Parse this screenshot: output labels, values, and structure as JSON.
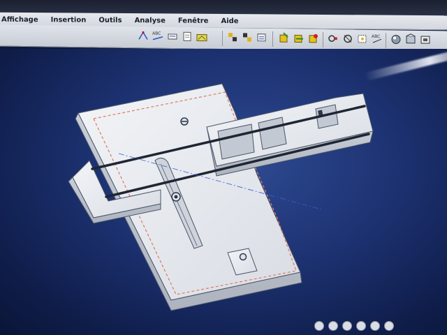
{
  "menubar": {
    "items": [
      {
        "label": "Affichage"
      },
      {
        "label": "Insertion"
      },
      {
        "label": "Outils"
      },
      {
        "label": "Analyse"
      },
      {
        "label": "Fenêtre"
      },
      {
        "label": "Aide"
      }
    ]
  },
  "toolbar": {
    "labels": {
      "small_text_1": "ABC",
      "small_text_2": "ABC"
    },
    "icons": [
      "measure-icon",
      "dimension-icon",
      "edit-icon",
      "coordinate-icon",
      "save-image-icon",
      "assembly-icon-1",
      "assembly-icon-2",
      "assembly-icon-3",
      "constraint-icon-1",
      "constraint-icon-2",
      "constraint-icon-3",
      "analysis-icon-1",
      "analysis-icon-2",
      "analysis-icon-3",
      "analysis-icon-4",
      "render-icon-1",
      "render-icon-2",
      "render-icon-3"
    ]
  },
  "colors": {
    "viewport_bg": "#1c3170",
    "part_face": "#e8ebef",
    "part_edge": "#4a5568",
    "sketch_dash": "#e07a5f"
  },
  "status": {
    "icons": [
      "status-icon-1",
      "status-icon-2",
      "status-icon-3",
      "status-icon-4",
      "status-icon-5",
      "status-icon-6"
    ]
  }
}
